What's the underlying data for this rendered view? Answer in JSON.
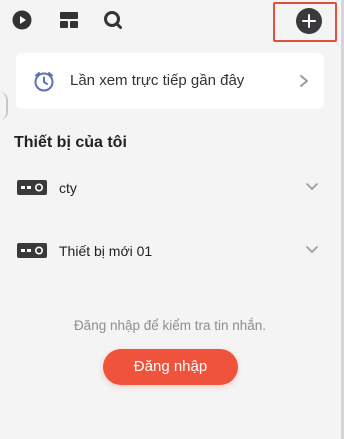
{
  "top_bar": {
    "icons": [
      "play-circle-icon",
      "layout-icon",
      "search-icon",
      "add-icon"
    ],
    "highlight_color": "#e0503c"
  },
  "recent_live": {
    "label": "Lần xem trực tiếp gần đây",
    "icon": "clock-icon",
    "accent_color": "#5b74b8"
  },
  "my_devices": {
    "title": "Thiết bị của tôi",
    "items": [
      {
        "name": "cty",
        "icon": "camera-device-icon"
      },
      {
        "name": "Thiết bị mới 01",
        "icon": "camera-device-icon"
      }
    ]
  },
  "login": {
    "message": "Đăng nhập để kiểm tra tin nhắn.",
    "button_label": "Đăng nhập",
    "button_color": "#f0533c"
  }
}
